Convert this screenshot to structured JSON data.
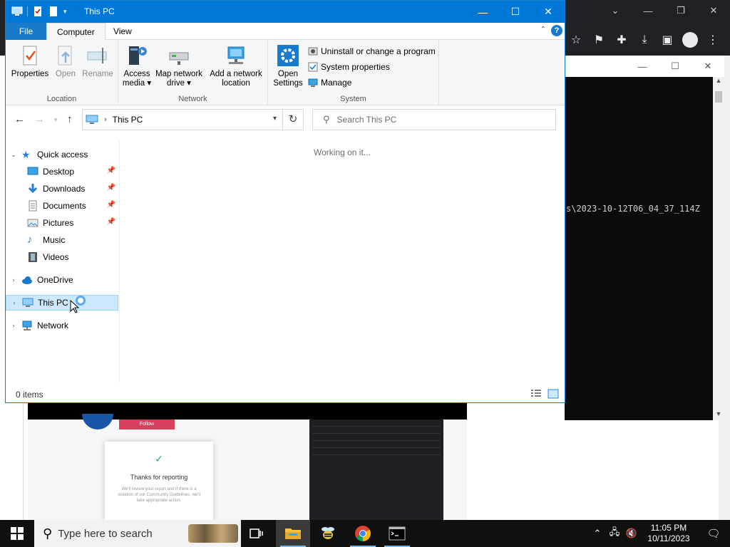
{
  "explorer": {
    "title": "This PC",
    "window_buttons": [
      "—",
      "☐",
      "✕"
    ],
    "ribbon_tabs": {
      "file": "File",
      "computer": "Computer",
      "view": "View"
    },
    "ribbon": {
      "location": {
        "name": "Location",
        "properties": "Properties",
        "open": "Open",
        "rename": "Rename"
      },
      "network": {
        "name": "Network",
        "access_media_1": "Access",
        "access_media_2": "media ▾",
        "map_drive_1": "Map network",
        "map_drive_2": "drive ▾",
        "add_location_1": "Add a network",
        "add_location_2": "location"
      },
      "system": {
        "name": "System",
        "open_settings_1": "Open",
        "open_settings_2": "Settings",
        "uninstall": "Uninstall or change a program",
        "system_properties": "System properties",
        "manage": "Manage"
      }
    },
    "address": {
      "location": "This PC"
    },
    "search": {
      "placeholder": "Search This PC"
    },
    "navigation": {
      "quick_access": "Quick access",
      "items": [
        {
          "label": "Desktop",
          "pinned": true
        },
        {
          "label": "Downloads",
          "pinned": true
        },
        {
          "label": "Documents",
          "pinned": true
        },
        {
          "label": "Pictures",
          "pinned": true
        },
        {
          "label": "Music",
          "pinned": false
        },
        {
          "label": "Videos",
          "pinned": false
        }
      ],
      "onedrive": "OneDrive",
      "this_pc": "This PC",
      "network": "Network"
    },
    "content": {
      "status_text": "Working on it..."
    },
    "status_bar": {
      "item_count": "0 items"
    }
  },
  "background": {
    "console_text": "s\\2023-10-12T06_04_37_114Z",
    "webpage": {
      "follow_label": "Follow",
      "modal_title": "Thanks for reporting",
      "modal_sub": "We'll review your report and if there is a violation of our Community Guidelines, we'll take appropriate action."
    }
  },
  "taskbar": {
    "search_placeholder": "Type here to search",
    "apps": [
      "task-view",
      "file-explorer",
      "app-bee",
      "chrome",
      "command-prompt"
    ],
    "time": "11:05 PM",
    "date": "10/11/2023"
  },
  "colors": {
    "accent": "#0078d7",
    "selection": "#cce8ff",
    "taskbar": "#101010"
  }
}
